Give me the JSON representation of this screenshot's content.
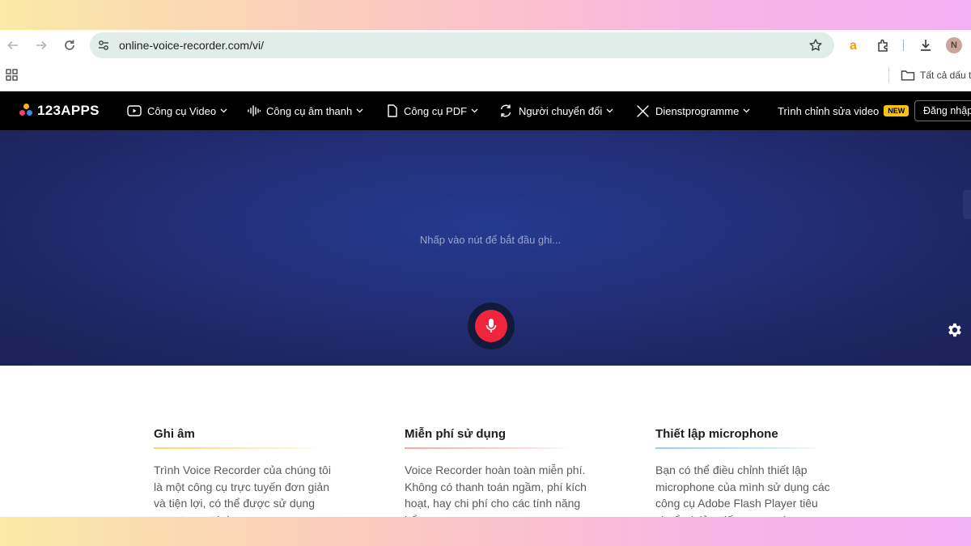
{
  "browser": {
    "url": "online-voice-recorder.com/vi/",
    "profile_initial": "N",
    "bookmark_folder": "Tất cả dấu t"
  },
  "site": {
    "logo_text": "123APPS",
    "nav": [
      {
        "label": "Công cụ Video",
        "icon": "video-icon"
      },
      {
        "label": "Công cụ âm thanh",
        "icon": "audio-wave-icon"
      },
      {
        "label": "Công cụ PDF",
        "icon": "file-icon"
      },
      {
        "label": "Người chuyển đổi",
        "icon": "convert-icon"
      },
      {
        "label": "Dienstprogramme",
        "icon": "tools-icon"
      }
    ],
    "video_editor": "Trình chỉnh sửa video",
    "new_badge": "NEW",
    "login": "Đăng nhập"
  },
  "recorder": {
    "hint": "Nhấp vào nút để bắt đầu ghi..."
  },
  "features": [
    {
      "title": "Ghi âm",
      "rule_color": "#f5d67a",
      "text": "Trình Voice Recorder của chúng tôi là một công cụ trực tuyến đơn giản và tiện lợi, có thể được sử dụng ngay trong trình"
    },
    {
      "title": "Miễn phí sử dụng",
      "rule_color": "#f4a8a0",
      "text": "Voice Recorder hoàn toàn miễn phí. Không có thanh toán ngầm, phí kích hoạt, hay chi phí cho các tính năng bổ sung."
    },
    {
      "title": "Thiết lập microphone",
      "rule_color": "#8fd0f0",
      "text": "Bạn có thể điều chỉnh thiết lập microphone của mình sử dụng các công cụ Adobe Flash Player tiêu chuẩn (giảm tiếng vọng và"
    }
  ],
  "colors": {
    "hero": "#22307a",
    "record": "#f0253c",
    "nav_bg": "#000000",
    "omnibox": "#e1ede9"
  }
}
